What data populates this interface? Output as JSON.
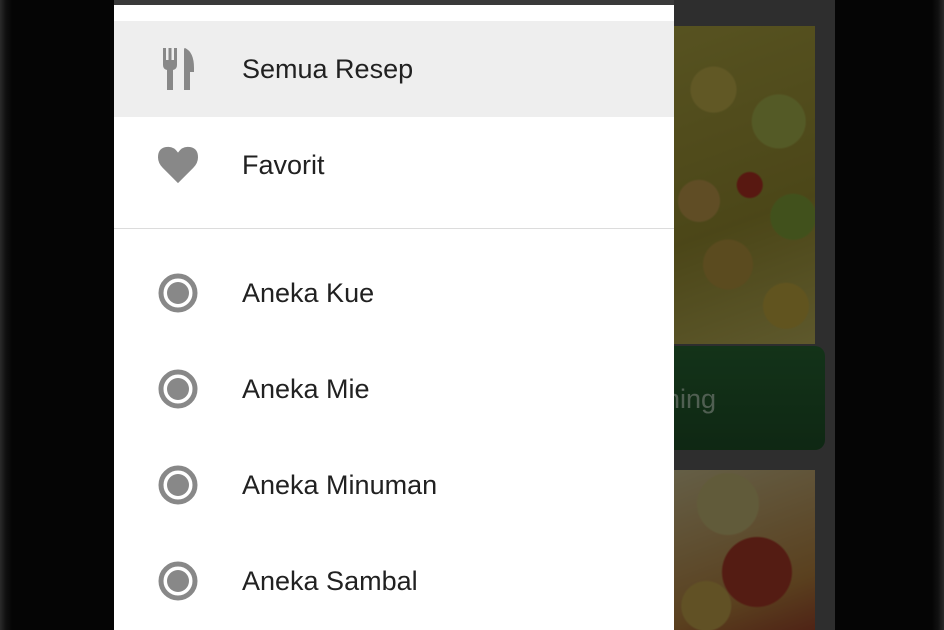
{
  "colors": {
    "drawer_background": "#ffffff",
    "active_item_background": "#eeeeee",
    "icon_gray": "#888888",
    "label_text": "#212121",
    "banner_green": "#2f7a3c"
  },
  "background": {
    "banner_text": "uning"
  },
  "drawer": {
    "primary_items": [
      {
        "label": "Semua Resep",
        "icon": "fork-knife-icon",
        "active": true
      },
      {
        "label": "Favorit",
        "icon": "heart-icon",
        "active": false
      }
    ],
    "category_items": [
      {
        "label": "Aneka Kue",
        "icon": "radio-circle-icon"
      },
      {
        "label": "Aneka Mie",
        "icon": "radio-circle-icon"
      },
      {
        "label": "Aneka Minuman",
        "icon": "radio-circle-icon"
      },
      {
        "label": "Aneka Sambal",
        "icon": "radio-circle-icon"
      }
    ]
  }
}
